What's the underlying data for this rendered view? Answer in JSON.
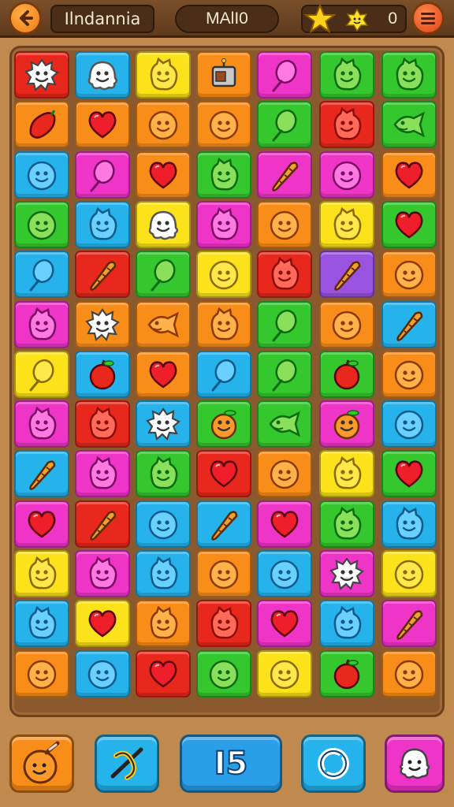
{
  "header": {
    "back_icon": "back-arrow-icon",
    "level_name": "Ilndannia",
    "mode_label": "MAlI0",
    "star_icon": "star-icon",
    "sun_icon": "sun-icon",
    "score": "0",
    "menu_icon": "menu-icon"
  },
  "palette": {
    "red": "#e8281c",
    "orange": "#f98d1a",
    "yellow": "#fbe21a",
    "green": "#35c72e",
    "blue": "#26b3ec",
    "magenta": "#ef34c8",
    "purple": "#9a52e0"
  },
  "board": {
    "rows": 13,
    "cols": 7,
    "tiles": [
      [
        "red:splat",
        "blue:ghost",
        "yellow:blob",
        "orange:robot",
        "magenta:balloon",
        "green:blob",
        "green:blob"
      ],
      [
        "orange:pepper",
        "orange:heart",
        "orange:face",
        "orange:face",
        "green:balloon",
        "red:blob",
        "green:fish"
      ],
      [
        "blue:face",
        "magenta:balloon",
        "orange:heart",
        "green:blob",
        "magenta:carrot",
        "magenta:face",
        "orange:heart"
      ],
      [
        "green:face",
        "blue:blob",
        "yellow:ghost",
        "magenta:blob",
        "orange:face",
        "yellow:blob",
        "green:heart"
      ],
      [
        "blue:balloon",
        "red:carrot",
        "green:balloon",
        "yellow:face",
        "red:blob",
        "purple:carrot",
        "orange:face"
      ],
      [
        "magenta:blob",
        "orange:splat",
        "orange:fish",
        "orange:blob",
        "green:balloon",
        "orange:face",
        "blue:carrot"
      ],
      [
        "yellow:balloon",
        "blue:apple",
        "orange:heart",
        "blue:balloon",
        "green:balloon",
        "green:apple",
        "orange:face"
      ],
      [
        "magenta:blob",
        "red:blob",
        "blue:splat",
        "green:fruit",
        "green:fish",
        "magenta:fruit",
        "blue:face"
      ],
      [
        "blue:carrot",
        "magenta:blob",
        "green:blob",
        "red:heart",
        "orange:face",
        "yellow:blob",
        "green:heart"
      ],
      [
        "magenta:heart",
        "red:carrot",
        "blue:face",
        "blue:carrot",
        "magenta:heart",
        "green:blob",
        "blue:blob"
      ],
      [
        "yellow:blob",
        "magenta:blob",
        "blue:blob",
        "orange:face",
        "blue:face",
        "magenta:splat",
        "yellow:face"
      ],
      [
        "blue:blob",
        "yellow:heart",
        "orange:blob",
        "red:blob",
        "magenta:heart",
        "blue:blob",
        "magenta:carrot"
      ],
      [
        "orange:face",
        "blue:face",
        "red:heart",
        "green:face",
        "yellow:face",
        "green:apple",
        "orange:face"
      ]
    ]
  },
  "footer": {
    "booster_left": {
      "color": "orange",
      "icon": "fruit-face-icon"
    },
    "booster_shuffle": {
      "color": "blue",
      "icon": "swap-icon"
    },
    "moves_label": "I5",
    "booster_ring": {
      "color": "blue",
      "icon": "ring-icon"
    },
    "booster_right": {
      "color": "magenta",
      "icon": "ghost-icon"
    }
  }
}
